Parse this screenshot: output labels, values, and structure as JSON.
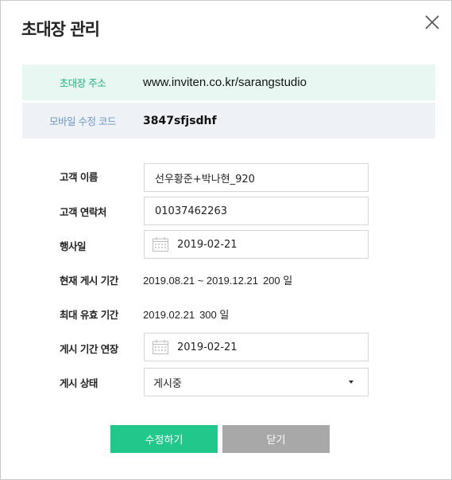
{
  "dialog": {
    "title": "초대장 관리"
  },
  "info": {
    "invite_address_label": "초대장 주소",
    "invite_address_value": "www.inviten.co.kr/sarangstudio",
    "mobile_code_label": "모바일 수정 코드",
    "mobile_code_value": "3847sfjsdhf"
  },
  "form": {
    "customer_name_label": "고객 이름",
    "customer_name_value": "선우황준+박나현_920",
    "customer_contact_label": "고객 연락처",
    "customer_contact_value": "01037462263",
    "event_date_label": "행사일",
    "event_date_value": "2019-02-21",
    "current_period_label": "현재 게시 기간",
    "current_period_value": "2019.08.21 ~ 2019.12.21",
    "current_period_days": "200 일",
    "max_valid_label": "최대 유효 기간",
    "max_valid_value": "2019.02.21",
    "max_valid_days": "300 일",
    "extend_label": "게시 기간 연장",
    "extend_value": "2019-02-21",
    "status_label": "게시 상태",
    "status_value": "게시중"
  },
  "buttons": {
    "save_label": "수정하기",
    "close_label": "닫기"
  },
  "colors": {
    "accent_green": "#22c78c",
    "close_gray": "#a8a8a8",
    "address_bg": "#e8f7f1",
    "code_bg": "#eef2f6"
  },
  "icons": {
    "close": "close-icon",
    "calendar": "calendar-icon",
    "dropdown": "caret-down-icon"
  }
}
